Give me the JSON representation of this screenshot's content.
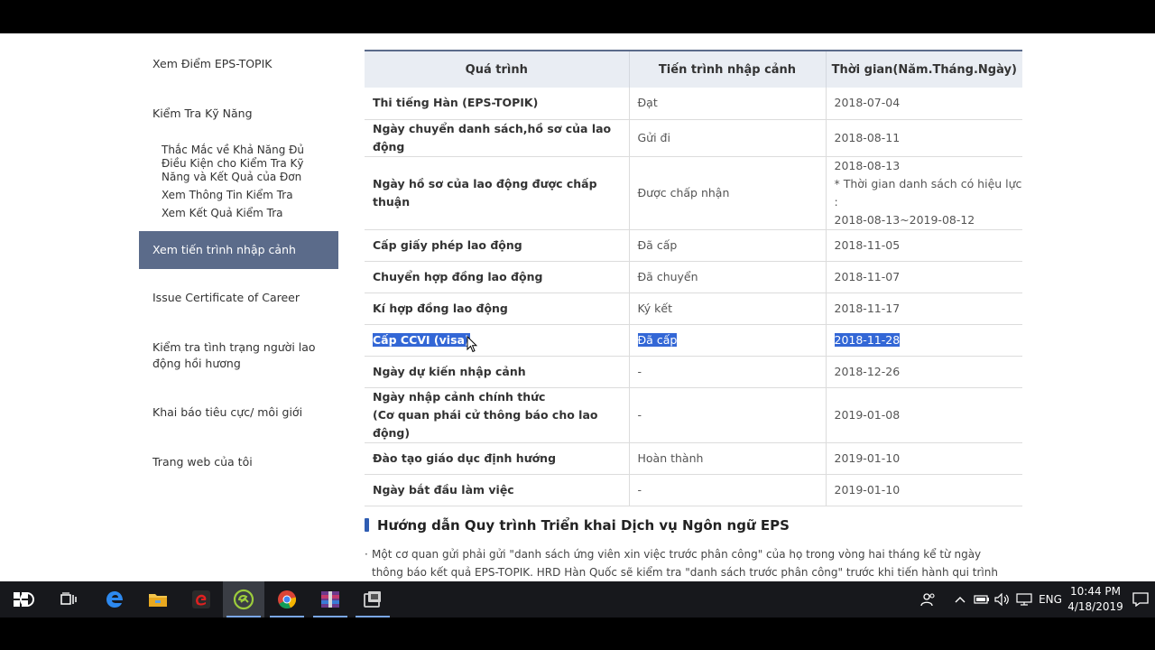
{
  "sidebar": {
    "items": [
      {
        "label": "Xem Điểm EPS-TOPIK"
      },
      {
        "label": "Kiểm Tra Kỹ Năng"
      },
      {
        "label": "Thắc Mắc về Khả Năng Đủ Điều Kiện cho Kiểm Tra Kỹ Năng và Kết Quả của Đơn"
      },
      {
        "label": "Xem Thông Tin Kiểm Tra"
      },
      {
        "label": "Xem Kết Quả Kiểm Tra"
      },
      {
        "label": "Xem tiến trình nhập cảnh"
      },
      {
        "label": "Issue Certificate of Career"
      },
      {
        "label": "Kiểm tra tình trạng người lao động hồi hương"
      },
      {
        "label": "Khai báo tiêu cực/ môi giới"
      },
      {
        "label": "Trang web của tôi"
      }
    ]
  },
  "table": {
    "headers": [
      "Quá trình",
      "Tiến trình nhập cảnh",
      "Thời gian(Năm.Tháng.Ngày)"
    ],
    "rows": [
      {
        "step": "Thi tiếng Hàn (EPS-TOPIK)",
        "status": "Đạt",
        "date": "2018-07-04"
      },
      {
        "step": "Ngày chuyển danh sách,hồ sơ của lao động",
        "status": "Gửi đi",
        "date": "2018-08-11"
      },
      {
        "step": "Ngày hồ sơ của lao động được chấp thuận",
        "status": "Được chấp nhận",
        "date": "2018-08-13",
        "date_note1": "* Thời gian danh sách có hiệu lực :",
        "date_note2": "2018-08-13~2019-08-12"
      },
      {
        "step": "Cấp giấy phép lao động",
        "status": "Đã cấp",
        "date": "2018-11-05"
      },
      {
        "step": "Chuyển hợp đồng lao động",
        "status": "Đã chuyển",
        "date": "2018-11-07"
      },
      {
        "step": "Kí hợp đồng lao động",
        "status": "Ký kết",
        "date": "2018-11-17"
      },
      {
        "step": "Cấp CCVI (visa)",
        "status": "Đã cấp",
        "date": "2018-11-28"
      },
      {
        "step": "Ngày dự kiến nhập cảnh",
        "status": "-",
        "date": "2018-12-26"
      },
      {
        "step": "Ngày nhập cảnh chính thức",
        "step2": "(Cơ quan phái cử thông báo cho lao động)",
        "status": "-",
        "date": "2019-01-08"
      },
      {
        "step": "Đào tạo giáo dục định hướng",
        "status": "Hoàn thành",
        "date": "2019-01-10"
      },
      {
        "step": "Ngày bắt đầu làm việc",
        "status": "-",
        "date": "2019-01-10"
      }
    ]
  },
  "guide": {
    "title": "Hướng dẫn Quy trình Triển khai Dịch vụ Ngôn ngữ EPS",
    "bullet": "·",
    "text": "Một cơ quan gửi phải gửi \"danh sách ứng viên xin việc trước phân công\" của họ trong vòng hai tháng kể từ ngày thông báo kết quả EPS-TOPIK. HRD Hàn Quốc sẽ kiểm tra \"danh sách trước phân công\" trước khi tiến hành qui trình phê duyệt."
  },
  "taskbar": {
    "language": "ENG",
    "time": "10:44 PM",
    "date": "4/18/2019",
    "icons": [
      "start-icon",
      "cortana-icon",
      "task-view-icon",
      "edge-icon",
      "file-explorer-icon",
      "garena-icon",
      "app-icon",
      "chrome-icon",
      "winrar-icon",
      "app-icon-2"
    ]
  },
  "colors": {
    "accent": "#5b6b8a",
    "selection": "#3367d6",
    "taskbar": "#17181c"
  }
}
